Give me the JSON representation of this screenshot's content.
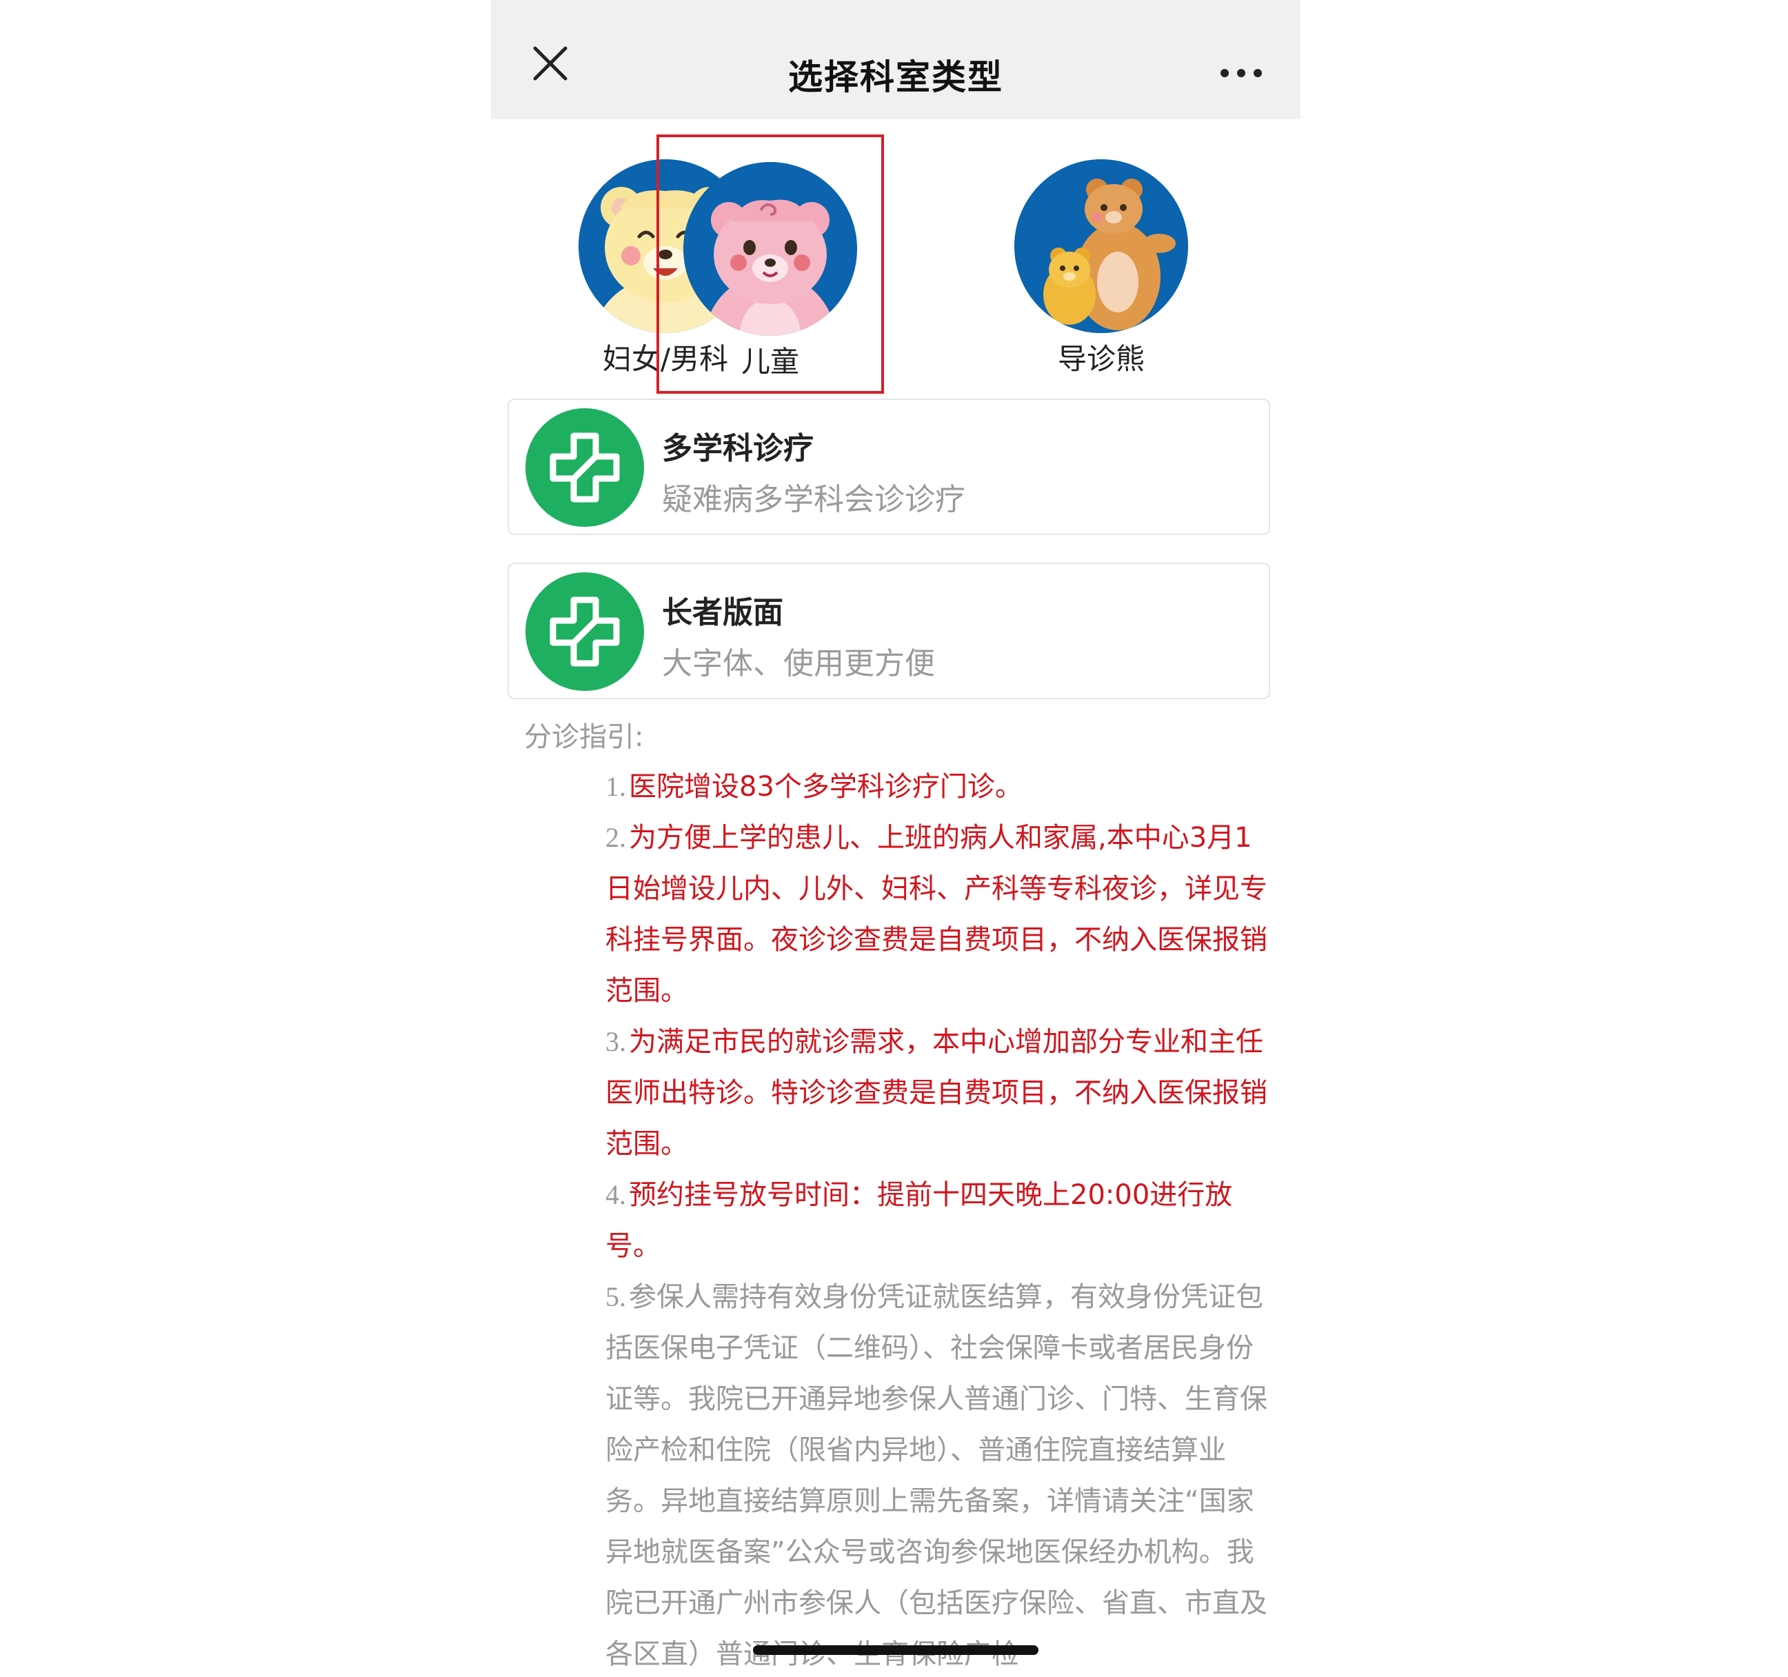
{
  "nav": {
    "title": "选择科室类型",
    "close_icon": "close-icon",
    "more_icon": "more-dots-icon"
  },
  "categories": [
    {
      "label": "妇女/男科",
      "icon": "yellow-bear-icon",
      "selected": false
    },
    {
      "label": "儿童",
      "icon": "pink-bear-icon",
      "selected": true
    },
    {
      "label": "导诊熊",
      "icon": "bear-family-icon",
      "selected": false
    }
  ],
  "cards": [
    {
      "title": "多学科诊疗",
      "subtitle": "疑难病多学科会诊诊疗",
      "icon": "medical-cross-icon"
    },
    {
      "title": "长者版面",
      "subtitle": "大字体、使用更方便",
      "icon": "medical-cross-icon"
    }
  ],
  "guide": {
    "title": "分诊指引:",
    "items": [
      {
        "num": "1.",
        "text": "医院增设83个多学科诊疗门诊。",
        "tone": "red"
      },
      {
        "num": "2.",
        "text": "为方便上学的患儿、上班的病人和家属,本中心3月1日始增设儿内、儿外、妇科、产科等专科夜诊，详见专科挂号界面。夜诊诊查费是自费项目，不纳入医保报销范围。",
        "tone": "red"
      },
      {
        "num": "3.",
        "text": "为满足市民的就诊需求，本中心增加部分专业和主任医师出特诊。特诊诊查费是自费项目，不纳入医保报销范围。",
        "tone": "red"
      },
      {
        "num": "4.",
        "text": "预约挂号放号时间：提前十四天晚上20:00进行放号。",
        "tone": "red"
      },
      {
        "num": "5.",
        "text": "参保人需持有效身份凭证就医结算，有效身份凭证包括医保电子凭证（二维码）、社会保障卡或者居民身份证等。我院已开通异地参保人普通门诊、门特、生育保险产检和住院（限省内异地）、普通住院直接结算业务。异地直接结算原则上需先备案，详情请关注“国家异地就医备案”公众号或咨询参保地医保经办机构。我院已开通广州市参保人（包括医疗保险、省直、市直及各区直）普通门诊、生育保险产检",
        "tone": "gray"
      }
    ]
  },
  "colors": {
    "selected_border": "#d4202a",
    "avatar_bg": "#0b64ad",
    "card_icon_bg": "#1eaf60",
    "notice_red": "#d0161e",
    "notice_gray": "#999999"
  }
}
